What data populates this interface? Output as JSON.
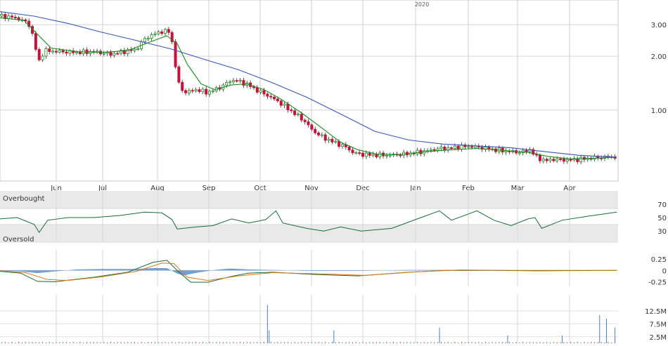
{
  "chart_data": [
    {
      "type": "candlestick",
      "panel": "price",
      "scale": "log",
      "year_label": "2020",
      "x_months": [
        "Jun",
        "Jul",
        "Aug",
        "Sep",
        "Oct",
        "Nov",
        "Dec",
        "Jan",
        "Feb",
        "Mar",
        "Apr"
      ],
      "y_ticks": [
        "3.00",
        "2.00",
        "1.00"
      ],
      "y_tick_values": [
        3.0,
        2.0,
        1.0
      ],
      "ylim": [
        0.48,
        3.7
      ],
      "close_path": [
        {
          "x": 0,
          "y": 3.35
        },
        {
          "x": 8,
          "y": 3.3
        },
        {
          "x": 14,
          "y": 3.15
        },
        {
          "x": 18,
          "y": 2.95
        },
        {
          "x": 20,
          "y": 2.35
        },
        {
          "x": 23,
          "y": 1.88
        },
        {
          "x": 26,
          "y": 2.15
        },
        {
          "x": 35,
          "y": 2.12
        },
        {
          "x": 45,
          "y": 2.1
        },
        {
          "x": 55,
          "y": 2.12
        },
        {
          "x": 65,
          "y": 2.05
        },
        {
          "x": 72,
          "y": 2.12
        },
        {
          "x": 80,
          "y": 2.18
        },
        {
          "x": 85,
          "y": 2.5
        },
        {
          "x": 90,
          "y": 2.65
        },
        {
          "x": 95,
          "y": 2.75
        },
        {
          "x": 99,
          "y": 2.75
        },
        {
          "x": 101,
          "y": 2.4
        },
        {
          "x": 104,
          "y": 1.45
        },
        {
          "x": 108,
          "y": 1.25
        },
        {
          "x": 115,
          "y": 1.3
        },
        {
          "x": 122,
          "y": 1.25
        },
        {
          "x": 130,
          "y": 1.35
        },
        {
          "x": 136,
          "y": 1.47
        },
        {
          "x": 140,
          "y": 1.45
        },
        {
          "x": 146,
          "y": 1.38
        },
        {
          "x": 150,
          "y": 1.3
        },
        {
          "x": 156,
          "y": 1.22
        },
        {
          "x": 163,
          "y": 1.12
        },
        {
          "x": 170,
          "y": 1.0
        },
        {
          "x": 178,
          "y": 0.88
        },
        {
          "x": 184,
          "y": 0.76
        },
        {
          "x": 190,
          "y": 0.7
        },
        {
          "x": 196,
          "y": 0.66
        },
        {
          "x": 203,
          "y": 0.62
        },
        {
          "x": 207,
          "y": 0.58
        },
        {
          "x": 212,
          "y": 0.565
        },
        {
          "x": 220,
          "y": 0.56
        },
        {
          "x": 230,
          "y": 0.56
        },
        {
          "x": 240,
          "y": 0.57
        },
        {
          "x": 250,
          "y": 0.59
        },
        {
          "x": 258,
          "y": 0.61
        },
        {
          "x": 264,
          "y": 0.61
        },
        {
          "x": 270,
          "y": 0.625
        },
        {
          "x": 277,
          "y": 0.625
        },
        {
          "x": 283,
          "y": 0.615
        },
        {
          "x": 290,
          "y": 0.6
        },
        {
          "x": 300,
          "y": 0.585
        },
        {
          "x": 306,
          "y": 0.58
        },
        {
          "x": 311,
          "y": 0.6
        },
        {
          "x": 315,
          "y": 0.545
        },
        {
          "x": 320,
          "y": 0.52
        },
        {
          "x": 325,
          "y": 0.53
        },
        {
          "x": 332,
          "y": 0.525
        },
        {
          "x": 340,
          "y": 0.53
        },
        {
          "x": 348,
          "y": 0.54
        },
        {
          "x": 355,
          "y": 0.545
        },
        {
          "x": 362,
          "y": 0.548
        }
      ],
      "series": [
        {
          "name": "",
          "color": "#1a8a1a",
          "values": [
            {
              "x": 0,
              "y": 3.28
            },
            {
              "x": 14,
              "y": 3.18
            },
            {
              "x": 22,
              "y": 2.65
            },
            {
              "x": 30,
              "y": 2.22
            },
            {
              "x": 45,
              "y": 2.12
            },
            {
              "x": 60,
              "y": 2.1
            },
            {
              "x": 75,
              "y": 2.15
            },
            {
              "x": 88,
              "y": 2.4
            },
            {
              "x": 98,
              "y": 2.6
            },
            {
              "x": 104,
              "y": 2.35
            },
            {
              "x": 110,
              "y": 1.8
            },
            {
              "x": 118,
              "y": 1.4
            },
            {
              "x": 126,
              "y": 1.3
            },
            {
              "x": 136,
              "y": 1.38
            },
            {
              "x": 145,
              "y": 1.4
            },
            {
              "x": 155,
              "y": 1.3
            },
            {
              "x": 165,
              "y": 1.15
            },
            {
              "x": 178,
              "y": 0.95
            },
            {
              "x": 190,
              "y": 0.78
            },
            {
              "x": 200,
              "y": 0.66
            },
            {
              "x": 210,
              "y": 0.6
            },
            {
              "x": 222,
              "y": 0.565
            },
            {
              "x": 235,
              "y": 0.565
            },
            {
              "x": 250,
              "y": 0.585
            },
            {
              "x": 265,
              "y": 0.6
            },
            {
              "x": 280,
              "y": 0.61
            },
            {
              "x": 295,
              "y": 0.595
            },
            {
              "x": 310,
              "y": 0.58
            },
            {
              "x": 322,
              "y": 0.55
            },
            {
              "x": 335,
              "y": 0.532
            },
            {
              "x": 350,
              "y": 0.538
            },
            {
              "x": 362,
              "y": 0.546
            }
          ]
        },
        {
          "name": "",
          "color": "#3a55b5",
          "values": [
            {
              "x": 0,
              "y": 3.55
            },
            {
              "x": 20,
              "y": 3.35
            },
            {
              "x": 40,
              "y": 3.05
            },
            {
              "x": 60,
              "y": 2.72
            },
            {
              "x": 80,
              "y": 2.45
            },
            {
              "x": 100,
              "y": 2.2
            },
            {
              "x": 120,
              "y": 1.92
            },
            {
              "x": 140,
              "y": 1.68
            },
            {
              "x": 160,
              "y": 1.42
            },
            {
              "x": 180,
              "y": 1.18
            },
            {
              "x": 200,
              "y": 0.95
            },
            {
              "x": 220,
              "y": 0.76
            },
            {
              "x": 240,
              "y": 0.68
            },
            {
              "x": 260,
              "y": 0.645
            },
            {
              "x": 280,
              "y": 0.63
            },
            {
              "x": 300,
              "y": 0.615
            },
            {
              "x": 320,
              "y": 0.585
            },
            {
              "x": 340,
              "y": 0.558
            },
            {
              "x": 362,
              "y": 0.545
            }
          ]
        }
      ]
    },
    {
      "type": "line",
      "panel": "rsi",
      "y_ticks": [
        "70",
        "50",
        "30"
      ],
      "y_tick_values": [
        70,
        50,
        30
      ],
      "ylim": [
        0,
        100
      ],
      "band_labels": {
        "upper": "Overbought",
        "lower": "Oversold"
      },
      "series": [
        {
          "name": "",
          "color": "#1a6a3a",
          "values": [
            {
              "x": 0,
              "y": 48
            },
            {
              "x": 10,
              "y": 50
            },
            {
              "x": 20,
              "y": 40
            },
            {
              "x": 23,
              "y": 28
            },
            {
              "x": 28,
              "y": 46
            },
            {
              "x": 40,
              "y": 50
            },
            {
              "x": 55,
              "y": 50
            },
            {
              "x": 70,
              "y": 53
            },
            {
              "x": 85,
              "y": 58
            },
            {
              "x": 95,
              "y": 57
            },
            {
              "x": 101,
              "y": 47
            },
            {
              "x": 104,
              "y": 33
            },
            {
              "x": 115,
              "y": 36
            },
            {
              "x": 125,
              "y": 38
            },
            {
              "x": 136,
              "y": 48
            },
            {
              "x": 146,
              "y": 42
            },
            {
              "x": 156,
              "y": 47
            },
            {
              "x": 162,
              "y": 60
            },
            {
              "x": 166,
              "y": 42
            },
            {
              "x": 180,
              "y": 34
            },
            {
              "x": 190,
              "y": 30
            },
            {
              "x": 200,
              "y": 36
            },
            {
              "x": 212,
              "y": 30
            },
            {
              "x": 230,
              "y": 34
            },
            {
              "x": 245,
              "y": 48
            },
            {
              "x": 258,
              "y": 60
            },
            {
              "x": 265,
              "y": 46
            },
            {
              "x": 280,
              "y": 60
            },
            {
              "x": 290,
              "y": 46
            },
            {
              "x": 300,
              "y": 38
            },
            {
              "x": 310,
              "y": 48
            },
            {
              "x": 314,
              "y": 50
            },
            {
              "x": 318,
              "y": 34
            },
            {
              "x": 330,
              "y": 46
            },
            {
              "x": 345,
              "y": 52
            },
            {
              "x": 362,
              "y": 58
            }
          ]
        }
      ]
    },
    {
      "type": "line",
      "panel": "macd",
      "y_ticks": [
        "0.25",
        "0",
        "-0.25"
      ],
      "y_tick_values": [
        0.25,
        0,
        -0.25
      ],
      "ylim": [
        -0.35,
        0.45
      ],
      "series": [
        {
          "name": "",
          "color": "#1a6a3a",
          "values": [
            {
              "x": 0,
              "y": -0.02
            },
            {
              "x": 12,
              "y": -0.06
            },
            {
              "x": 22,
              "y": -0.24
            },
            {
              "x": 32,
              "y": -0.25
            },
            {
              "x": 55,
              "y": -0.15
            },
            {
              "x": 75,
              "y": -0.04
            },
            {
              "x": 90,
              "y": 0.18
            },
            {
              "x": 98,
              "y": 0.22
            },
            {
              "x": 104,
              "y": 0.0
            },
            {
              "x": 112,
              "y": -0.26
            },
            {
              "x": 122,
              "y": -0.26
            },
            {
              "x": 136,
              "y": -0.13
            },
            {
              "x": 146,
              "y": -0.06
            },
            {
              "x": 160,
              "y": -0.04
            },
            {
              "x": 185,
              "y": -0.09
            },
            {
              "x": 210,
              "y": -0.12
            },
            {
              "x": 240,
              "y": -0.04
            },
            {
              "x": 262,
              "y": 0.0
            },
            {
              "x": 290,
              "y": 0.0
            },
            {
              "x": 315,
              "y": -0.01
            },
            {
              "x": 362,
              "y": 0.0
            }
          ]
        },
        {
          "name": "",
          "color": "#e07a10",
          "values": [
            {
              "x": 0,
              "y": -0.01
            },
            {
              "x": 15,
              "y": -0.05
            },
            {
              "x": 28,
              "y": -0.2
            },
            {
              "x": 40,
              "y": -0.22
            },
            {
              "x": 60,
              "y": -0.14
            },
            {
              "x": 80,
              "y": -0.02
            },
            {
              "x": 95,
              "y": 0.16
            },
            {
              "x": 102,
              "y": 0.15
            },
            {
              "x": 110,
              "y": -0.15
            },
            {
              "x": 122,
              "y": -0.22
            },
            {
              "x": 140,
              "y": -0.12
            },
            {
              "x": 160,
              "y": -0.05
            },
            {
              "x": 190,
              "y": -0.08
            },
            {
              "x": 215,
              "y": -0.11
            },
            {
              "x": 245,
              "y": -0.03
            },
            {
              "x": 270,
              "y": 0.01
            },
            {
              "x": 300,
              "y": 0.0
            },
            {
              "x": 362,
              "y": 0.0
            }
          ]
        },
        {
          "name": "",
          "color": "#5b8ed0",
          "type": "histogram",
          "values": [
            {
              "x": 0,
              "y": -0.01
            },
            {
              "x": 12,
              "y": -0.02
            },
            {
              "x": 22,
              "y": -0.06
            },
            {
              "x": 30,
              "y": -0.03
            },
            {
              "x": 45,
              "y": 0.02
            },
            {
              "x": 60,
              "y": 0.03
            },
            {
              "x": 80,
              "y": 0.03
            },
            {
              "x": 90,
              "y": 0.05
            },
            {
              "x": 98,
              "y": 0.05
            },
            {
              "x": 104,
              "y": -0.07
            },
            {
              "x": 108,
              "y": -0.11
            },
            {
              "x": 116,
              "y": -0.05
            },
            {
              "x": 126,
              "y": 0.01
            },
            {
              "x": 135,
              "y": 0.04
            },
            {
              "x": 146,
              "y": 0.02
            },
            {
              "x": 160,
              "y": 0.01
            },
            {
              "x": 180,
              "y": -0.01
            },
            {
              "x": 210,
              "y": -0.01
            },
            {
              "x": 240,
              "y": 0.01
            },
            {
              "x": 262,
              "y": 0.01
            },
            {
              "x": 300,
              "y": -0.01
            },
            {
              "x": 320,
              "y": -0.01
            },
            {
              "x": 362,
              "y": 0.005
            }
          ]
        }
      ]
    },
    {
      "type": "bar",
      "panel": "volume",
      "y_ticks": [
        "12.5M",
        "7.5M",
        "2.5M"
      ],
      "y_tick_values": [
        12.5,
        7.5,
        2.5
      ],
      "ylim": [
        0,
        16
      ],
      "spikes": [
        {
          "x": 157,
          "y": 14.8
        },
        {
          "x": 158,
          "y": 5.0
        },
        {
          "x": 196,
          "y": 5.0
        },
        {
          "x": 258,
          "y": 6.0
        },
        {
          "x": 298,
          "y": 3.0
        },
        {
          "x": 330,
          "y": 3.0
        },
        {
          "x": 352,
          "y": 10.8
        },
        {
          "x": 356,
          "y": 9.5
        },
        {
          "x": 361,
          "y": 6.0
        }
      ]
    }
  ]
}
